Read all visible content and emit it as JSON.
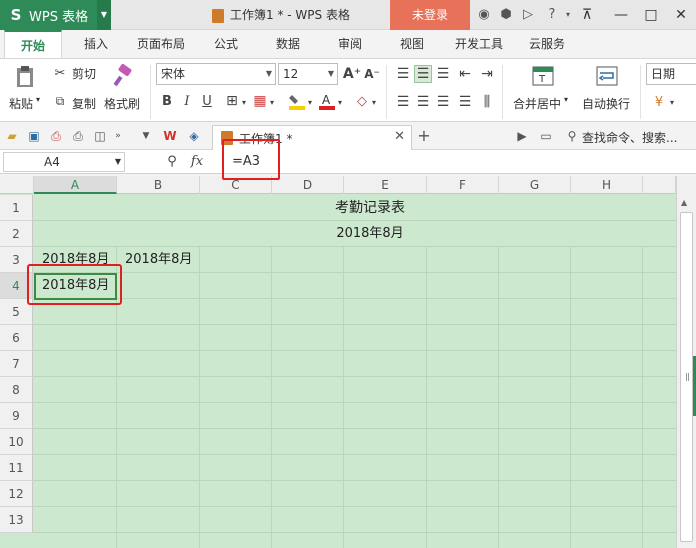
{
  "titlebar": {
    "app_name": "WPS 表格",
    "doc_title": "工作簿1 * - WPS 表格",
    "login_label": "未登录"
  },
  "menu": {
    "tabs": [
      "开始",
      "插入",
      "页面布局",
      "公式",
      "数据",
      "审阅",
      "视图",
      "开发工具",
      "云服务"
    ],
    "active": "开始"
  },
  "ribbon": {
    "paste_label": "粘贴",
    "cut_label": "剪切",
    "copy_label": "复制",
    "format_painter_label": "格式刷",
    "font_name": "宋体",
    "font_size": "12",
    "merge_center_label": "合并居中",
    "wrap_text_label": "自动换行",
    "number_format": "日期"
  },
  "quickbar": {
    "doc_tab_label": "工作簿1 *",
    "search_label": "查找命令、搜索..."
  },
  "formula_bar": {
    "name_box": "A4",
    "fx_label": "fx",
    "formula": "=A3"
  },
  "sheet": {
    "columns": [
      "A",
      "B",
      "C",
      "D",
      "E",
      "F",
      "G",
      "H"
    ],
    "selected_column": "A",
    "rows": [
      "1",
      "2",
      "3",
      "4",
      "5",
      "6",
      "7",
      "8",
      "9",
      "10",
      "11",
      "12",
      "13"
    ],
    "selected_row": "4",
    "cells": {
      "title": "考勤记录表",
      "subtitle": "2018年8月",
      "a3": "2018年8月",
      "b3": "2018年8月",
      "a4": "2018年8月"
    }
  },
  "colors": {
    "accent": "#2e8b57",
    "login": "#e8715a",
    "grid_bg": "#cce8cf",
    "highlight": "#e02020"
  }
}
